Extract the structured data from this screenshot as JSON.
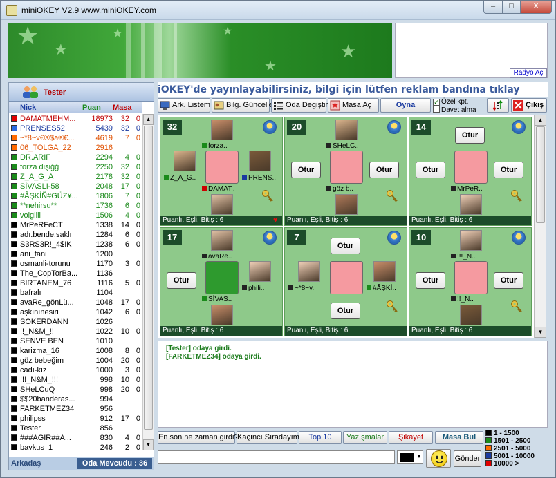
{
  "window": {
    "title": "miniOKEY V2.9 www.miniOKEY.com",
    "min": "–",
    "max": "□",
    "close": "X"
  },
  "header": {
    "radio_button": "Radyo Aç"
  },
  "user": {
    "name": "Tester"
  },
  "players": {
    "columns": {
      "nick": "Nick",
      "puan": "Puan",
      "masa": "Masa"
    },
    "rows": [
      {
        "nick": "DAMATMEHM...",
        "puan": "18973",
        "masa": "32",
        "bit": "0",
        "color": "#e00000",
        "text": "#c00000"
      },
      {
        "nick": "PRENSES52",
        "puan": "5439",
        "masa": "32",
        "bit": "0",
        "color": "#2a6ae0",
        "text": "#1a3aa0"
      },
      {
        "nick": "~*8~v€®$a®€...",
        "puan": "4619",
        "masa": "7",
        "bit": "0",
        "color": "#ff6a00",
        "text": "#e05000"
      },
      {
        "nick": "06_TOLGA_22",
        "puan": "2916",
        "masa": "",
        "bit": "",
        "color": "#ff6a00",
        "text": "#e05000"
      },
      {
        "nick": "DR.ARIF",
        "puan": "2294",
        "masa": "4",
        "bit": "0",
        "color": "#1a8a1a",
        "text": "#1a8a1a"
      },
      {
        "nick": "forza dişiğğ",
        "puan": "2250",
        "masa": "32",
        "bit": "0",
        "color": "#1a8a1a",
        "text": "#1a8a1a"
      },
      {
        "nick": "Z_A_G_A",
        "puan": "2178",
        "masa": "32",
        "bit": "0",
        "color": "#1a8a1a",
        "text": "#1a8a1a"
      },
      {
        "nick": "SİVASLI-58",
        "puan": "2048",
        "masa": "17",
        "bit": "0",
        "color": "#1a8a1a",
        "text": "#1a8a1a"
      },
      {
        "nick": "#ÂŞKİÑ#GÜZ¥...",
        "puan": "1806",
        "masa": "7",
        "bit": "0",
        "color": "#1a8a1a",
        "text": "#1a8a1a"
      },
      {
        "nick": "**nehirsu**",
        "puan": "1736",
        "masa": "6",
        "bit": "0",
        "color": "#1a8a1a",
        "text": "#1a8a1a"
      },
      {
        "nick": "volgiiii",
        "puan": "1506",
        "masa": "4",
        "bit": "0",
        "color": "#1a8a1a",
        "text": "#1a8a1a"
      },
      {
        "nick": "MrPeRFeCT",
        "puan": "1338",
        "masa": "14",
        "bit": "0",
        "color": "#000000",
        "text": "#000000"
      },
      {
        "nick": "adı.bende.saklı",
        "puan": "1284",
        "masa": "6",
        "bit": "0",
        "color": "#000000",
        "text": "#000000"
      },
      {
        "nick": "S3RS3R!_4$IK",
        "puan": "1238",
        "masa": "6",
        "bit": "0",
        "color": "#000000",
        "text": "#000000"
      },
      {
        "nick": "ani_fani",
        "puan": "1200",
        "masa": "",
        "bit": "",
        "color": "#000000",
        "text": "#000000"
      },
      {
        "nick": "osmanli-torunu",
        "puan": "1170",
        "masa": "3",
        "bit": "0",
        "color": "#000000",
        "text": "#000000"
      },
      {
        "nick": "The_CopTorBa...",
        "puan": "1136",
        "masa": "",
        "bit": "",
        "color": "#000000",
        "text": "#000000"
      },
      {
        "nick": "BIRTANEM_76",
        "puan": "1116",
        "masa": "5",
        "bit": "0",
        "color": "#000000",
        "text": "#000000"
      },
      {
        "nick": "bafralı",
        "puan": "1104",
        "masa": "",
        "bit": "",
        "color": "#000000",
        "text": "#000000"
      },
      {
        "nick": "avaRe_gönLü...",
        "puan": "1048",
        "masa": "17",
        "bit": "0",
        "color": "#000000",
        "text": "#000000"
      },
      {
        "nick": "aşkınınesiri",
        "puan": "1042",
        "masa": "6",
        "bit": "0",
        "color": "#000000",
        "text": "#000000"
      },
      {
        "nick": "SOKERDANN",
        "puan": "1026",
        "masa": "",
        "bit": "",
        "color": "#000000",
        "text": "#000000"
      },
      {
        "nick": "!!_N&M_!!",
        "puan": "1022",
        "masa": "10",
        "bit": "0",
        "color": "#000000",
        "text": "#000000"
      },
      {
        "nick": "SENVE BEN",
        "puan": "1010",
        "masa": "",
        "bit": "",
        "color": "#000000",
        "text": "#000000"
      },
      {
        "nick": "karizma_16",
        "puan": "1008",
        "masa": "8",
        "bit": "0",
        "color": "#000000",
        "text": "#000000"
      },
      {
        "nick": "göz bebeğim",
        "puan": "1004",
        "masa": "20",
        "bit": "0",
        "color": "#000000",
        "text": "#000000"
      },
      {
        "nick": "cadı-kız",
        "puan": "1000",
        "masa": "3",
        "bit": "0",
        "color": "#000000",
        "text": "#000000"
      },
      {
        "nick": "!!!_N&M_!!!",
        "puan": "998",
        "masa": "10",
        "bit": "0",
        "color": "#000000",
        "text": "#000000"
      },
      {
        "nick": "SHeLCuQ",
        "puan": "998",
        "masa": "20",
        "bit": "0",
        "color": "#000000",
        "text": "#000000"
      },
      {
        "nick": "$$20banderas...",
        "puan": "994",
        "masa": "",
        "bit": "",
        "color": "#000000",
        "text": "#000000"
      },
      {
        "nick": "FARKETMEZ34",
        "puan": "956",
        "masa": "",
        "bit": "",
        "color": "#000000",
        "text": "#000000"
      },
      {
        "nick": "philipss",
        "puan": "912",
        "masa": "17",
        "bit": "0",
        "color": "#000000",
        "text": "#000000"
      },
      {
        "nick": "Tester",
        "puan": "856",
        "masa": "",
        "bit": "",
        "color": "#000000",
        "text": "#000000"
      },
      {
        "nick": "###AGIR##A...",
        "puan": "830",
        "masa": "4",
        "bit": "0",
        "color": "#000000",
        "text": "#000000"
      },
      {
        "nick": "baykuş_1",
        "puan": "246",
        "masa": "2",
        "bit": "0",
        "color": "#000000",
        "text": "#000000"
      }
    ],
    "footer_left": "Arkadaş",
    "footer_right": "Oda Mevcudu : 36"
  },
  "marquee": "iOKEY'de yayınlayabilirsiniz, bilgi için lütfen reklam bandına tıklay",
  "toolbar": {
    "ark_listem": "Ark. Listem",
    "bilg_guncelle": "Bilg. Güncelle",
    "oda_degistir": "Oda Degiştir",
    "masa_ac": "Masa Aç",
    "oyna": "Oyna",
    "ozel_kpt": "Özel kpt.",
    "davet_alma": "Davet alma",
    "cikis": "Çıkış"
  },
  "tables": [
    {
      "num": "32",
      "footer": "Puanlı, Eşli, Bitiş : 6",
      "top": "forza..",
      "left": "Z_A_G..",
      "right": "PRENS..",
      "bottom": "DAMAT..",
      "center_color": "#f59aa0"
    },
    {
      "num": "20",
      "footer": "Puanlı, Eşli, Bitiş : 6",
      "top": "SHeLC..",
      "left": "",
      "right": "",
      "bottom": "göz b..",
      "center_color": "#f59aa0"
    },
    {
      "num": "14",
      "footer": "Puanlı, Eşli, Bitiş : 6",
      "top": "",
      "left": "",
      "right": "",
      "bottom": "MrPeR..",
      "center_color": "#f59aa0"
    },
    {
      "num": "17",
      "footer": "Puanlı, Eşli, Bitiş : 6",
      "top": "avaRe..",
      "left": "",
      "right": "phili..",
      "bottom": "SİVAS..",
      "center_color": "#2e9a2e"
    },
    {
      "num": "7",
      "footer": "Puanlı, Eşli, Bitiş : 6",
      "top": "",
      "left": "~*8~v..",
      "right": "#ÂŞKİ..",
      "bottom": "",
      "center_color": "#f59aa0"
    },
    {
      "num": "10",
      "footer": "Puanlı, Eşli, Bitiş : 6",
      "top": "!!!_N..",
      "left": "",
      "right": "",
      "bottom": "!!_N..",
      "center_color": "#f59aa0"
    }
  ],
  "otur": "Otur",
  "chat": [
    "[Tester] odaya girdi.",
    "[FARKETMEZ34] odaya girdi."
  ],
  "bottom_buttons": {
    "en_son": "En son ne zaman girdi?",
    "kacinci": "Kaçıncı Sıradayım",
    "top10": "Top 10",
    "yazismalar": "Yazışmalar",
    "sikayet": "Şikayet",
    "masa_bul": "Masa Bul"
  },
  "send": "Gönder",
  "legend": [
    {
      "label": "1 - 1500",
      "color": "#000000"
    },
    {
      "label": "1501 - 2500",
      "color": "#1a8a1a"
    },
    {
      "label": "2501 - 5000",
      "color": "#ff6a00"
    },
    {
      "label": "5001 - 10000",
      "color": "#1a3aa0"
    },
    {
      "label": "10000 >",
      "color": "#e00000"
    }
  ]
}
